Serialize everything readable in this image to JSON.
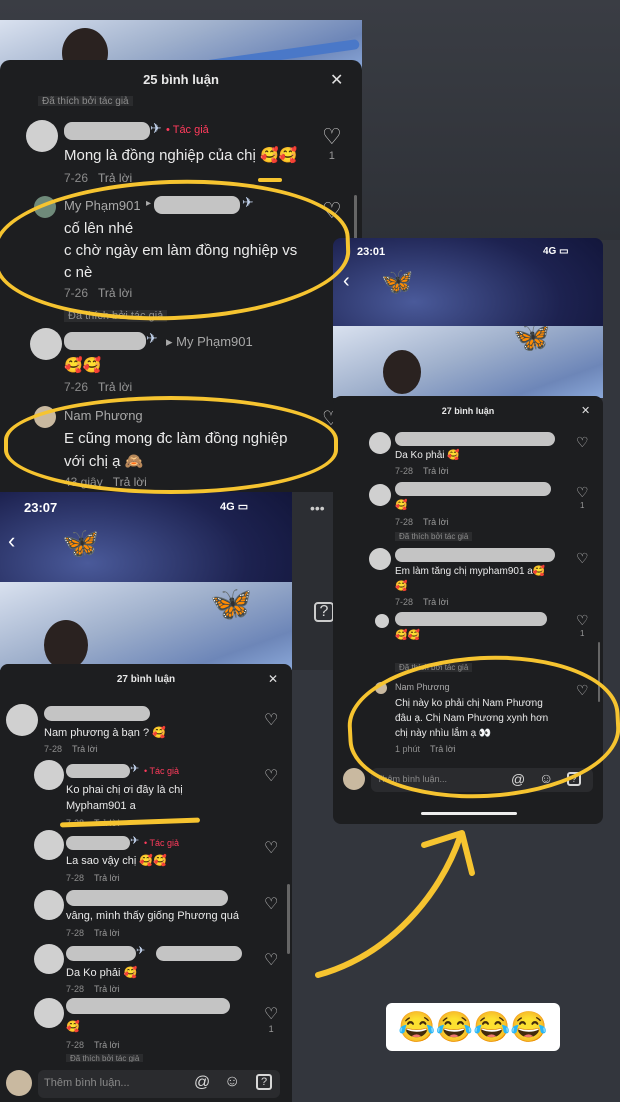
{
  "panel1": {
    "title": "25 bình luận",
    "close": "✕",
    "liked_top": "Đã thích bởi tác giả",
    "c1": {
      "tag": "Tác giả",
      "text": "Mong là đồng nghiệp của chị 🥰🥰",
      "time": "7-26",
      "reply": "Trả lời",
      "likes": "1"
    },
    "c2": {
      "user": "My Phạm901",
      "text1": "cố lên nhé",
      "text2": "c chờ ngày em làm đồng nghiệp vs",
      "text3": "c nè",
      "time": "7-26",
      "reply": "Trả lời"
    },
    "liked2": "Đã thích bởi tác giả",
    "c3": {
      "to": "My Phạm901",
      "text": "🥰🥰",
      "time": "7-26",
      "reply": "Trả lời"
    },
    "c4": {
      "user": "Nam Phương",
      "text1": "E cũng mong đc làm đồng nghiệp",
      "text2": "với chị ạ 🙈",
      "time": "43 giây",
      "reply": "Trả lời"
    }
  },
  "panel2": {
    "time": "23:07",
    "net": "4G",
    "title": "27 bình luận",
    "close": "✕",
    "c1": {
      "text": "Nam phương à bạn ? 🥰",
      "time": "7-28",
      "reply": "Trả lời"
    },
    "c2": {
      "tag": "Tác giả",
      "text1": "Ko phai chị ơi đây là chị",
      "text2": "Mypham901 a",
      "time": "7-28",
      "reply": "Trả lời"
    },
    "c3": {
      "tag": "Tác giả",
      "text": "La sao vậy chị 🥰🥰",
      "time": "7-28",
      "reply": "Trả lời"
    },
    "c4": {
      "text": "vâng, mình thấy giống Phương quá",
      "time": "7-28",
      "reply": "Trả lời"
    },
    "c5": {
      "text": "Da Ko phải 🥰",
      "time": "7-28",
      "reply": "Trả lời"
    },
    "c6": {
      "text": "🥰",
      "time": "7-28",
      "reply": "Trả lời",
      "likes": "1"
    },
    "liked": "Đã thích bởi tác giả",
    "input_placeholder": "Thêm bình luận..."
  },
  "panel3": {
    "time": "23:01",
    "net": "4G",
    "title": "27 bình luận",
    "close": "✕",
    "c1": {
      "text": "Da Ko phải 🥰",
      "time": "7-28",
      "reply": "Trả lời"
    },
    "c2": {
      "text": "🥰",
      "time": "7-28",
      "reply": "Trả lời",
      "likes": "1"
    },
    "liked1": "Đã thích bởi tác giả",
    "c3": {
      "text": "Em làm tăng chị mypham901 a🥰",
      "text2": "🥰",
      "time": "7-28",
      "reply": "Trả lời"
    },
    "c4": {
      "text": "🥰🥰",
      "likes": "1"
    },
    "liked2": "Đã thích bởi tác giả",
    "c5": {
      "user": "Nam Phương",
      "text1": "Chị này ko phải chị Nam Phương",
      "text2": "đâu ạ. Chị Nam Phương xynh hơn",
      "text3": "chị này nhìu lắm ạ 👀",
      "time": "1 phút",
      "reply": "Trả lời"
    },
    "input_placeholder": "Thêm bình luận..."
  },
  "emojis": "😂😂😂😂",
  "colors": {
    "highlight": "#f6c430",
    "author_tag": "#ff3b5c",
    "panel": "#1d1e20"
  }
}
